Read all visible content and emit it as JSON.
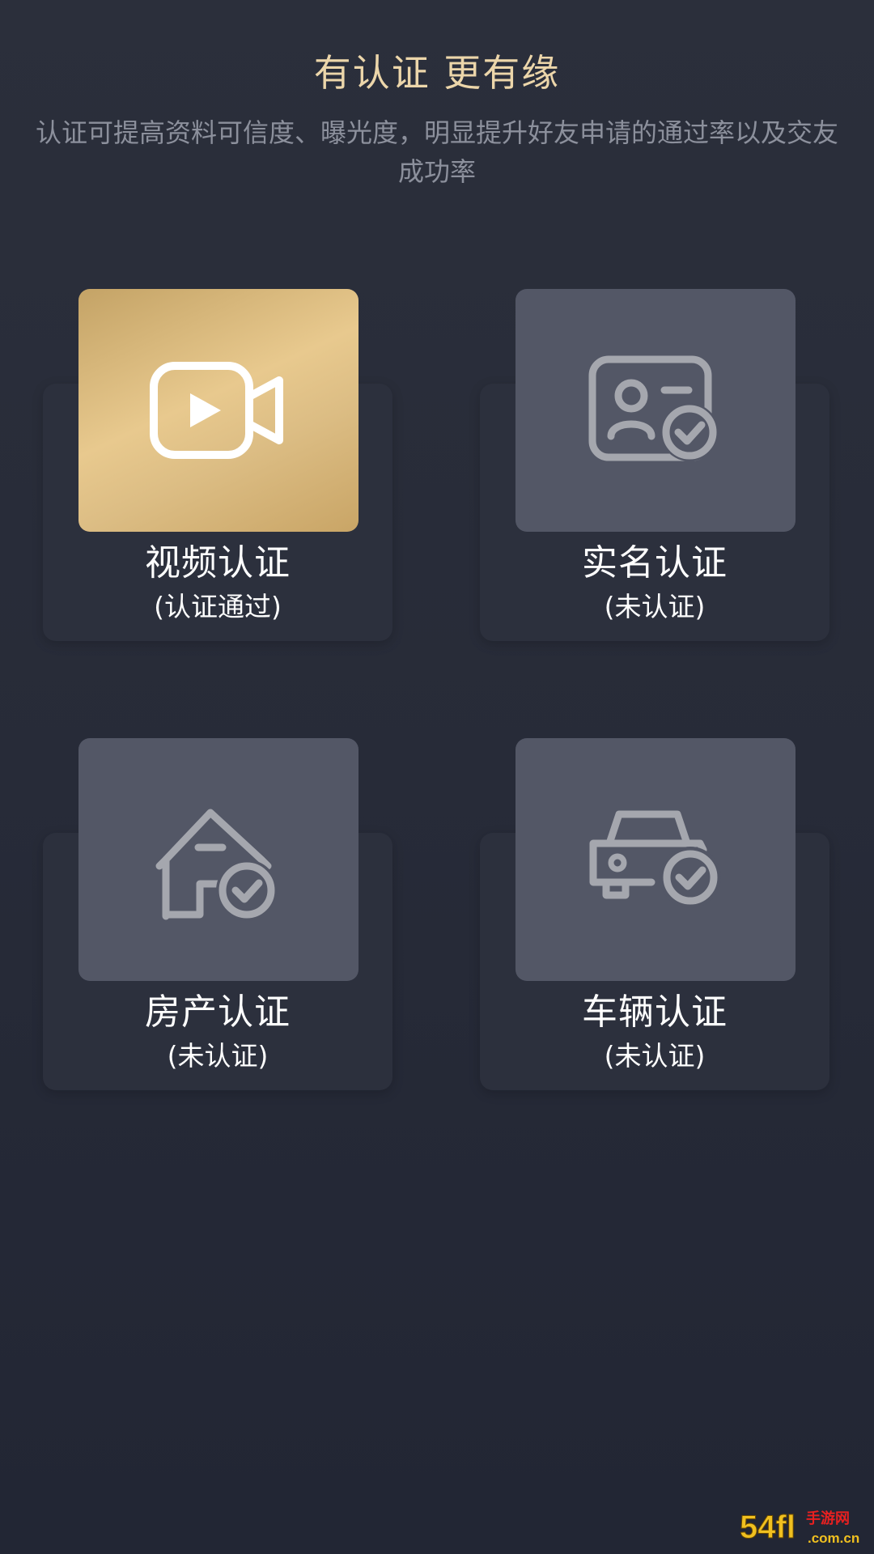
{
  "header": {
    "title": "有认证 更有缘",
    "subtitle": "认证可提高资料可信度、曝光度，明显提升好友申请的通过率以及交友成功率"
  },
  "cards": [
    {
      "name": "视频认证",
      "status": "(认证通过)",
      "icon": "video-camera-icon",
      "verified": true
    },
    {
      "name": "实名认证",
      "status": "(未认证)",
      "icon": "id-card-check-icon",
      "verified": false
    },
    {
      "name": "房产认证",
      "status": "(未认证)",
      "icon": "house-check-icon",
      "verified": false
    },
    {
      "name": "车辆认证",
      "status": "(未认证)",
      "icon": "car-check-icon",
      "verified": false
    }
  ],
  "colors": {
    "title": "#ecd6aa",
    "verified_bg": "#e8c98e",
    "unverified_bg": "#535766",
    "icon_gray": "#a5a7ae"
  },
  "watermark": {
    "logo": "54fl",
    "text": "手游网",
    "domain": ".com.cn"
  }
}
